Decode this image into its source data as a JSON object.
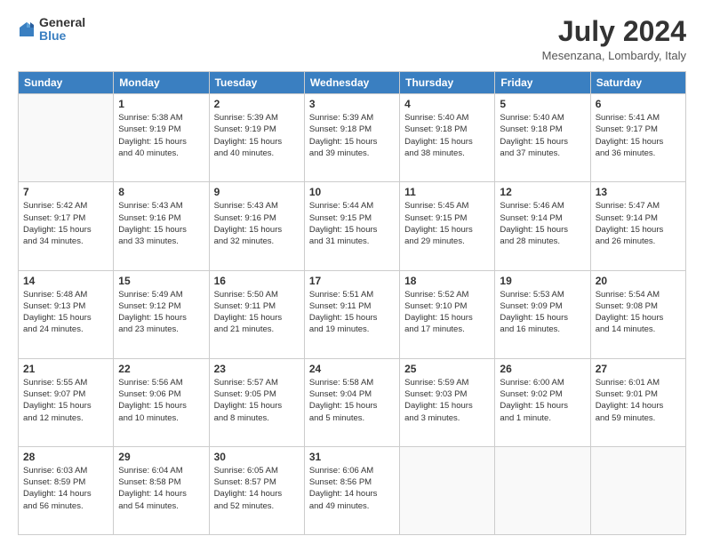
{
  "header": {
    "logo_general": "General",
    "logo_blue": "Blue",
    "title": "July 2024",
    "location": "Mesenzana, Lombardy, Italy"
  },
  "calendar": {
    "headers": [
      "Sunday",
      "Monday",
      "Tuesday",
      "Wednesday",
      "Thursday",
      "Friday",
      "Saturday"
    ],
    "rows": [
      [
        {
          "day": "",
          "info": ""
        },
        {
          "day": "1",
          "info": "Sunrise: 5:38 AM\nSunset: 9:19 PM\nDaylight: 15 hours\nand 40 minutes."
        },
        {
          "day": "2",
          "info": "Sunrise: 5:39 AM\nSunset: 9:19 PM\nDaylight: 15 hours\nand 40 minutes."
        },
        {
          "day": "3",
          "info": "Sunrise: 5:39 AM\nSunset: 9:18 PM\nDaylight: 15 hours\nand 39 minutes."
        },
        {
          "day": "4",
          "info": "Sunrise: 5:40 AM\nSunset: 9:18 PM\nDaylight: 15 hours\nand 38 minutes."
        },
        {
          "day": "5",
          "info": "Sunrise: 5:40 AM\nSunset: 9:18 PM\nDaylight: 15 hours\nand 37 minutes."
        },
        {
          "day": "6",
          "info": "Sunrise: 5:41 AM\nSunset: 9:17 PM\nDaylight: 15 hours\nand 36 minutes."
        }
      ],
      [
        {
          "day": "7",
          "info": "Sunrise: 5:42 AM\nSunset: 9:17 PM\nDaylight: 15 hours\nand 34 minutes."
        },
        {
          "day": "8",
          "info": "Sunrise: 5:43 AM\nSunset: 9:16 PM\nDaylight: 15 hours\nand 33 minutes."
        },
        {
          "day": "9",
          "info": "Sunrise: 5:43 AM\nSunset: 9:16 PM\nDaylight: 15 hours\nand 32 minutes."
        },
        {
          "day": "10",
          "info": "Sunrise: 5:44 AM\nSunset: 9:15 PM\nDaylight: 15 hours\nand 31 minutes."
        },
        {
          "day": "11",
          "info": "Sunrise: 5:45 AM\nSunset: 9:15 PM\nDaylight: 15 hours\nand 29 minutes."
        },
        {
          "day": "12",
          "info": "Sunrise: 5:46 AM\nSunset: 9:14 PM\nDaylight: 15 hours\nand 28 minutes."
        },
        {
          "day": "13",
          "info": "Sunrise: 5:47 AM\nSunset: 9:14 PM\nDaylight: 15 hours\nand 26 minutes."
        }
      ],
      [
        {
          "day": "14",
          "info": "Sunrise: 5:48 AM\nSunset: 9:13 PM\nDaylight: 15 hours\nand 24 minutes."
        },
        {
          "day": "15",
          "info": "Sunrise: 5:49 AM\nSunset: 9:12 PM\nDaylight: 15 hours\nand 23 minutes."
        },
        {
          "day": "16",
          "info": "Sunrise: 5:50 AM\nSunset: 9:11 PM\nDaylight: 15 hours\nand 21 minutes."
        },
        {
          "day": "17",
          "info": "Sunrise: 5:51 AM\nSunset: 9:11 PM\nDaylight: 15 hours\nand 19 minutes."
        },
        {
          "day": "18",
          "info": "Sunrise: 5:52 AM\nSunset: 9:10 PM\nDaylight: 15 hours\nand 17 minutes."
        },
        {
          "day": "19",
          "info": "Sunrise: 5:53 AM\nSunset: 9:09 PM\nDaylight: 15 hours\nand 16 minutes."
        },
        {
          "day": "20",
          "info": "Sunrise: 5:54 AM\nSunset: 9:08 PM\nDaylight: 15 hours\nand 14 minutes."
        }
      ],
      [
        {
          "day": "21",
          "info": "Sunrise: 5:55 AM\nSunset: 9:07 PM\nDaylight: 15 hours\nand 12 minutes."
        },
        {
          "day": "22",
          "info": "Sunrise: 5:56 AM\nSunset: 9:06 PM\nDaylight: 15 hours\nand 10 minutes."
        },
        {
          "day": "23",
          "info": "Sunrise: 5:57 AM\nSunset: 9:05 PM\nDaylight: 15 hours\nand 8 minutes."
        },
        {
          "day": "24",
          "info": "Sunrise: 5:58 AM\nSunset: 9:04 PM\nDaylight: 15 hours\nand 5 minutes."
        },
        {
          "day": "25",
          "info": "Sunrise: 5:59 AM\nSunset: 9:03 PM\nDaylight: 15 hours\nand 3 minutes."
        },
        {
          "day": "26",
          "info": "Sunrise: 6:00 AM\nSunset: 9:02 PM\nDaylight: 15 hours\nand 1 minute."
        },
        {
          "day": "27",
          "info": "Sunrise: 6:01 AM\nSunset: 9:01 PM\nDaylight: 14 hours\nand 59 minutes."
        }
      ],
      [
        {
          "day": "28",
          "info": "Sunrise: 6:03 AM\nSunset: 8:59 PM\nDaylight: 14 hours\nand 56 minutes."
        },
        {
          "day": "29",
          "info": "Sunrise: 6:04 AM\nSunset: 8:58 PM\nDaylight: 14 hours\nand 54 minutes."
        },
        {
          "day": "30",
          "info": "Sunrise: 6:05 AM\nSunset: 8:57 PM\nDaylight: 14 hours\nand 52 minutes."
        },
        {
          "day": "31",
          "info": "Sunrise: 6:06 AM\nSunset: 8:56 PM\nDaylight: 14 hours\nand 49 minutes."
        },
        {
          "day": "",
          "info": ""
        },
        {
          "day": "",
          "info": ""
        },
        {
          "day": "",
          "info": ""
        }
      ]
    ]
  }
}
